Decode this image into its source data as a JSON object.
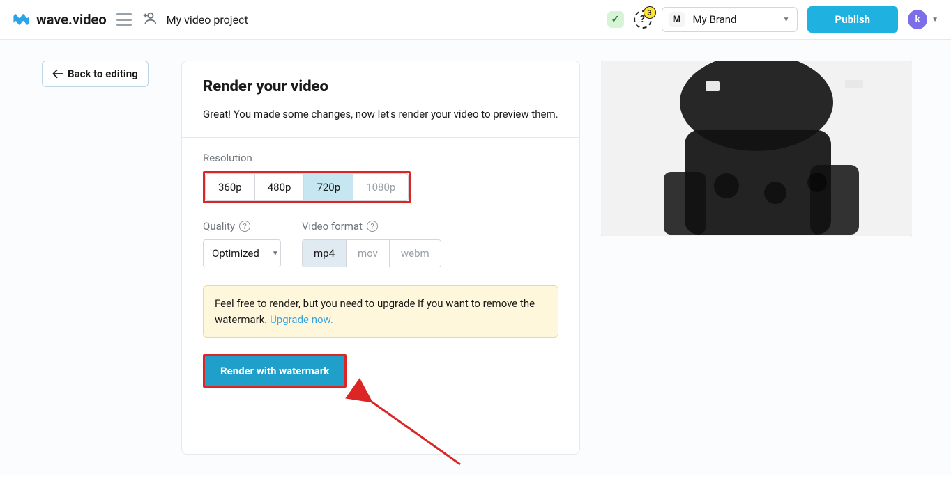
{
  "header": {
    "logo_text": "wave.video",
    "project_name": "My video project",
    "help_count": "3",
    "brand_letter": "M",
    "brand_label": "My Brand",
    "publish_label": "Publish",
    "avatar_letter": "k"
  },
  "back_label": "Back to editing",
  "card": {
    "title": "Render your video",
    "subtitle": "Great! You made some changes, now let's render your video to preview them.",
    "resolution_label": "Resolution",
    "resolutions": [
      "360p",
      "480p",
      "720p",
      "1080p"
    ],
    "quality_label": "Quality",
    "quality_value": "Optimized",
    "format_label": "Video format",
    "formats": [
      "mp4",
      "mov",
      "webm"
    ],
    "banner_text": "Feel free to render, but you need to upgrade if you want to remove the watermark. ",
    "banner_link": "Upgrade now.",
    "render_label": "Render with watermark"
  }
}
